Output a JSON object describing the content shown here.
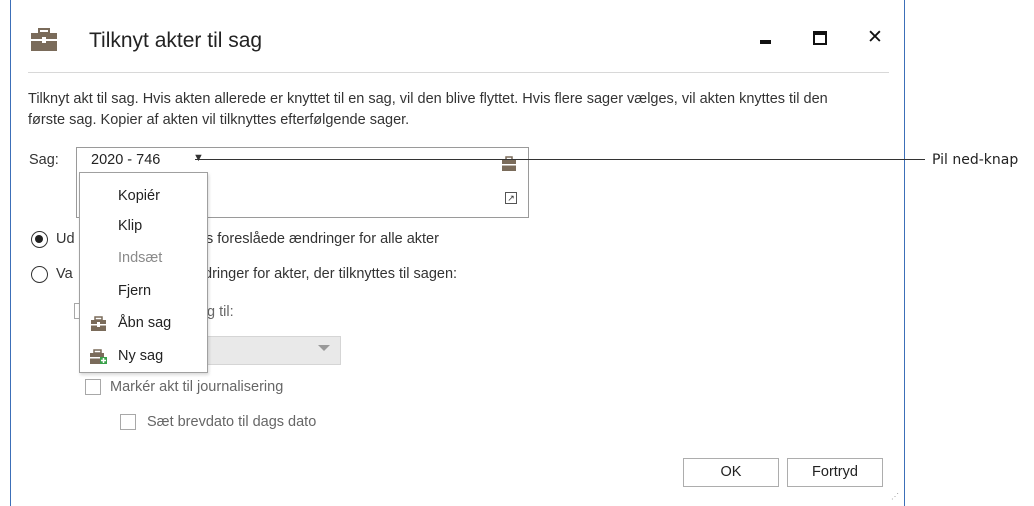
{
  "dialog": {
    "title": "Tilknyt akter til sag",
    "description": "Tilknyt akt til sag. Hvis akten allerede er knyttet til en sag, vil den blive flyttet. Hvis flere sager vælges, vil akten knyttes til den første sag. Kopier af akten vil tilknyttes efterfølgende sager.",
    "sag_label": "Sag:",
    "sag_value": "2020 - 746",
    "callout_label": "Pil ned-knap",
    "radio1": {
      "pre": "Ud",
      "post": "s foreslåede ændringer for alle akter",
      "checked": true
    },
    "radio2": {
      "pre": "Va",
      "post": "dringer for akter, der tilknyttes til sagen:",
      "checked": false
    },
    "til_text": "g til:",
    "checkbox_journal": "Markér akt til journalisering",
    "checkbox_brevdato": "Sæt brevdato til dags dato",
    "ok_label": "OK",
    "cancel_label": "Fortryd"
  },
  "context_menu": {
    "items": [
      {
        "label": "Kopiér",
        "enabled": true
      },
      {
        "label": "Klip",
        "enabled": true
      },
      {
        "label": "Indsæt",
        "enabled": false
      },
      {
        "label": "Fjern",
        "enabled": true
      },
      {
        "label": "Åbn sag",
        "enabled": true,
        "icon": "case-icon"
      },
      {
        "label": "Ny sag",
        "enabled": true,
        "icon": "new-case-icon"
      }
    ]
  },
  "colors": {
    "accent": "#3c6fb8",
    "icon_brown": "#7a6b5a",
    "icon_green": "#3aa14a"
  }
}
